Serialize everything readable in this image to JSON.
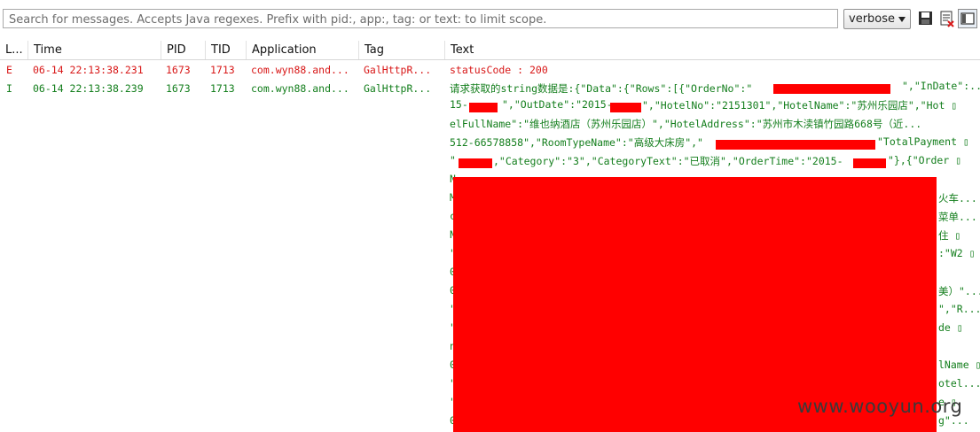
{
  "search": {
    "placeholder": "Search for messages. Accepts Java regexes. Prefix with pid:, app:, tag: or text: to limit scope."
  },
  "level_select": {
    "value": "verbose"
  },
  "columns": [
    "L...",
    "Time",
    "PID",
    "TID",
    "Application",
    "Tag",
    "Text"
  ],
  "rows": [
    {
      "level": "E",
      "time": "06-14 22:13:38.231",
      "pid": "1673",
      "tid": "1713",
      "app": "com.wyn88.and...",
      "tag": "GalHttpR...",
      "text": "statusCode : 200"
    },
    {
      "level": "I",
      "time": "06-14 22:13:38.239",
      "pid": "1673",
      "tid": "1713",
      "app": "com.wyn88.and...",
      "tag": "GalHttpR...",
      "text": "请求获取的string数据是:{\"Data\":{\"Rows\":[{\"OrderNo\":\""
    }
  ],
  "text_fragments": [
    "\",\"InDate\":...",
    "15-",
    "\",\"OutDate\":\"2015-",
    "\",\"HotelNo\":\"2151301\",\"HotelName\":\"苏州乐园店\",\"Hot ▯",
    "elFullName\":\"维也纳酒店（苏州乐园店）\",\"HotelAddress\":\"苏州市木渎镇竹园路668号（近...",
    "512-66578858\",\"RoomTypeName\":\"高级大床房\",\"",
    "\"TotalPayment ▯",
    "\"",
    ",\"Category\":\"3\",\"CategoryText\":\"已取消\",\"OrderTime\":\"2015-",
    "\"},{\"Order ▯",
    "N",
    "M",
    "火车...",
    "c",
    "菜单...",
    "N",
    "住 ▯",
    "\"",
    ":\"W2 ▯",
    "0",
    "0",
    "美）\"...",
    "\"",
    "\",\"R...",
    "\"",
    "de ▯",
    "n",
    "0",
    "lName ▯",
    "\"",
    "otel...",
    "\"",
    "e ▯",
    "0",
    "g\"..."
  ],
  "watermark": "www.wooyun.org",
  "colors": {
    "error": "#d81818",
    "info": "#137e1c",
    "redaction": "#ff0000"
  }
}
